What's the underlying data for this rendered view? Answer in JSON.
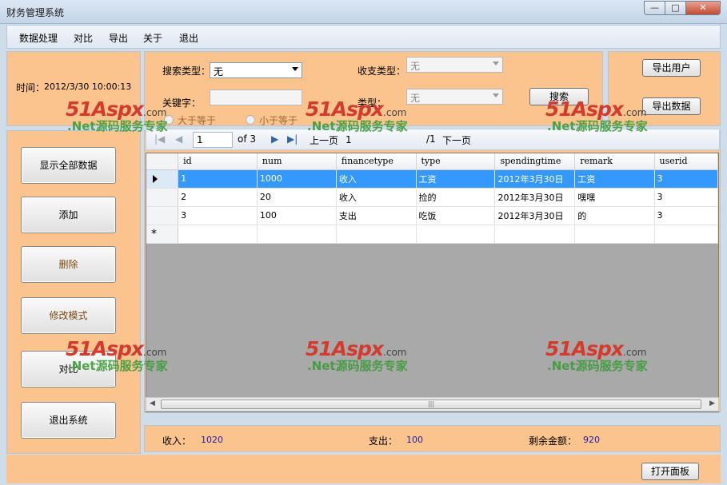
{
  "window": {
    "title": "财务管理系统",
    "min_label": "—",
    "max_label": "□",
    "close_label": "✕"
  },
  "menu": {
    "items": [
      "数据处理",
      "对比",
      "导出",
      "关于",
      "退出"
    ]
  },
  "time_panel": {
    "label": "时间：",
    "value": "2012/3/30 10:00:13"
  },
  "search": {
    "search_type_label": "搜索类型：",
    "search_type_value": "无",
    "income_type_label": "收支类型：",
    "income_type_value": "无",
    "keyword_label": "关键字：",
    "keyword_value": "",
    "type_label": "类型：",
    "type_value": "无",
    "search_button": "搜索",
    "radio_ge": "大于等于",
    "radio_le": "小于等于"
  },
  "export": {
    "export_users": "导出用户",
    "export_data": "导出数据"
  },
  "sidebar": {
    "buttons": [
      "显示全部数据",
      "添加",
      "删除",
      "修改模式",
      "对比",
      "退出系统"
    ]
  },
  "navigator": {
    "first": "|◀",
    "prev": "◀",
    "position": "1",
    "of_total": "of 3",
    "next": "▶",
    "last": "▶|",
    "prev_page": "上一页",
    "page_value": "1",
    "page_total": "/1",
    "next_page": "下一页"
  },
  "grid": {
    "columns": [
      "id",
      "num",
      "financetype",
      "type",
      "spendingtime",
      "remark",
      "userid"
    ],
    "rows": [
      [
        "1",
        "1000",
        "收入",
        "工资",
        "2012年3月30日",
        "工资",
        "3"
      ],
      [
        "2",
        "20",
        "收入",
        "捡的",
        "2012年3月30日",
        "嘿嘿",
        "3"
      ],
      [
        "3",
        "100",
        "支出",
        "吃饭",
        "2012年3月30日",
        "的",
        "3"
      ]
    ],
    "new_row_marker": "*",
    "selected_row": 0
  },
  "summary": {
    "income_label": "收入：",
    "income_value": "1020",
    "expense_label": "支出：",
    "expense_value": "100",
    "balance_label": "剩余金额：",
    "balance_value": "920"
  },
  "footer": {
    "open_panel_button": "打开面板"
  },
  "watermark": {
    "brand": "51Aspx",
    "domain": ".com",
    "slogan": ".Net源码服务专家"
  },
  "colors": {
    "panel": "#fbc48e",
    "selection": "#3399ff",
    "watermark_red": "#d43b2f",
    "watermark_green": "#3d9b3a"
  }
}
